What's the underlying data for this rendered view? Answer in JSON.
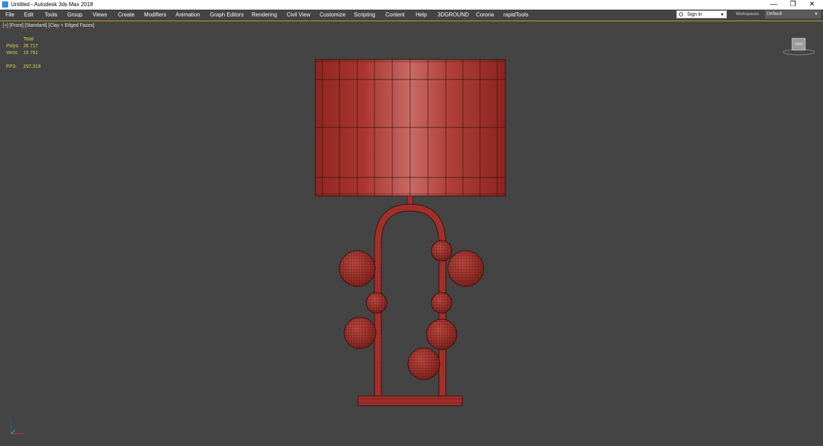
{
  "window": {
    "title": "Untitled - Autodesk 3ds Max 2018",
    "controls": {
      "minimize": "—",
      "restore": "❐",
      "close": "✕"
    }
  },
  "menu": {
    "items": [
      "File",
      "Edit",
      "Tools",
      "Group",
      "Views",
      "Create",
      "Modifiers",
      "Animation",
      "Graph Editors",
      "Rendering",
      "Civil View",
      "Customize",
      "Scripting",
      "Content",
      "Help",
      "3DGROUND",
      "Corona",
      "rapidTools"
    ]
  },
  "account": {
    "sign_in_label": "Sign In",
    "workspaces_label": "Workspaces:",
    "workspace_value": "Default"
  },
  "viewport": {
    "label_parts": [
      "[+]",
      "[Front]",
      "[Standard]",
      "[Clay + Edged Faces]"
    ],
    "stats": {
      "header": "Total",
      "polys_label": "Polys:",
      "polys_value": "26 717",
      "verts_label": "Verts:",
      "verts_value": "15 751",
      "fps_label": "FPS:",
      "fps_value": "297,318"
    }
  },
  "colors": {
    "viewport_bg": "#444444",
    "model_fill": "#a3302b",
    "wire": "#3a0f0c",
    "stats_text": "#e6d44a",
    "active_border": "#d6a62f"
  },
  "icons": {
    "app": "3dsmax-icon",
    "viewcube": "viewcube-icon",
    "axis": "axis-tripod-icon",
    "user": "user-icon",
    "dropdown": "chevron-down-icon"
  }
}
